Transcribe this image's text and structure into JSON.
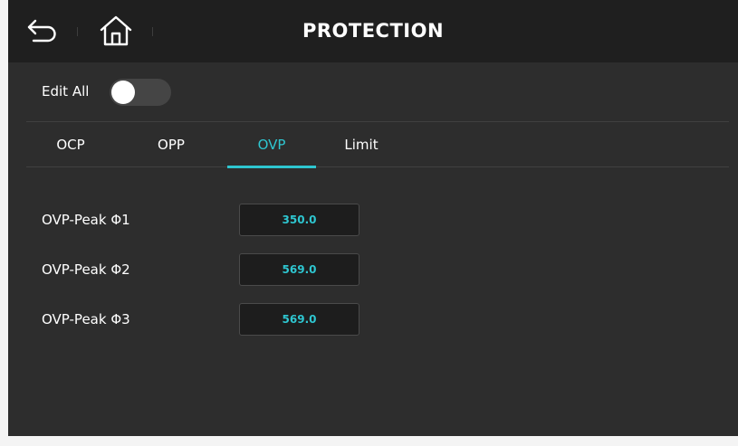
{
  "header": {
    "title": "PROTECTION",
    "back_icon": "back-arrow-icon",
    "home_icon": "home-icon"
  },
  "edit_all": {
    "label": "Edit All",
    "enabled": false
  },
  "tabs": [
    {
      "label": "OCP",
      "active": false
    },
    {
      "label": "OPP",
      "active": false
    },
    {
      "label": "OVP",
      "active": true
    },
    {
      "label": "Limit",
      "active": false
    }
  ],
  "params": [
    {
      "label": "OVP-Peak Φ1",
      "value": "350.0"
    },
    {
      "label": "OVP-Peak Φ2",
      "value": "569.0"
    },
    {
      "label": "OVP-Peak Φ3",
      "value": "569.0"
    }
  ],
  "colors": {
    "accent": "#2ec6d0",
    "background": "#2d2d2d",
    "header": "#1f1f1f"
  }
}
